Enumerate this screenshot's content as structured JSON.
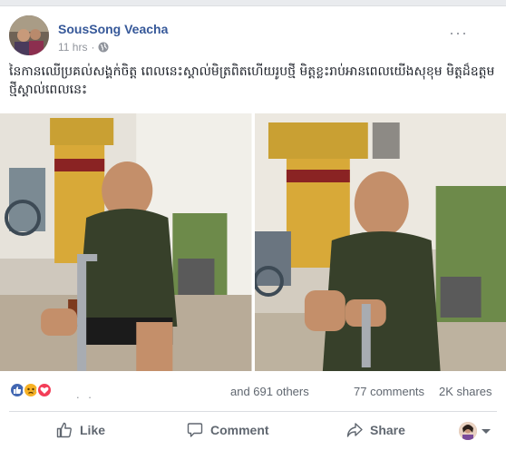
{
  "post": {
    "author": "SousSong Veacha",
    "time": "11 hrs",
    "audience_icon": "globe-icon",
    "caption": "នៃកានឈើប្រគល់សង្គក់ចិត្ត ពេលនេះស្គាល់មិត្រពិតហើយរូបថ្មី មិត្តខ្លះរាប់អានពេលយើងសុខុម មិត្តដ៏ឧត្តមថ្មីស្គាល់ពេលនេះ"
  },
  "stats": {
    "reaction_icons": [
      "like-icon",
      "sad-icon",
      "love-icon"
    ],
    "dots": ". .",
    "others": "and 691 others",
    "comments": "77 comments",
    "shares": "2K shares"
  },
  "actions": {
    "like": "Like",
    "comment": "Comment",
    "share": "Share"
  },
  "colors": {
    "link": "#365899",
    "like_blue": "#4267b2",
    "love_red": "#f33e58",
    "sad_yellow": "#f7b125"
  }
}
